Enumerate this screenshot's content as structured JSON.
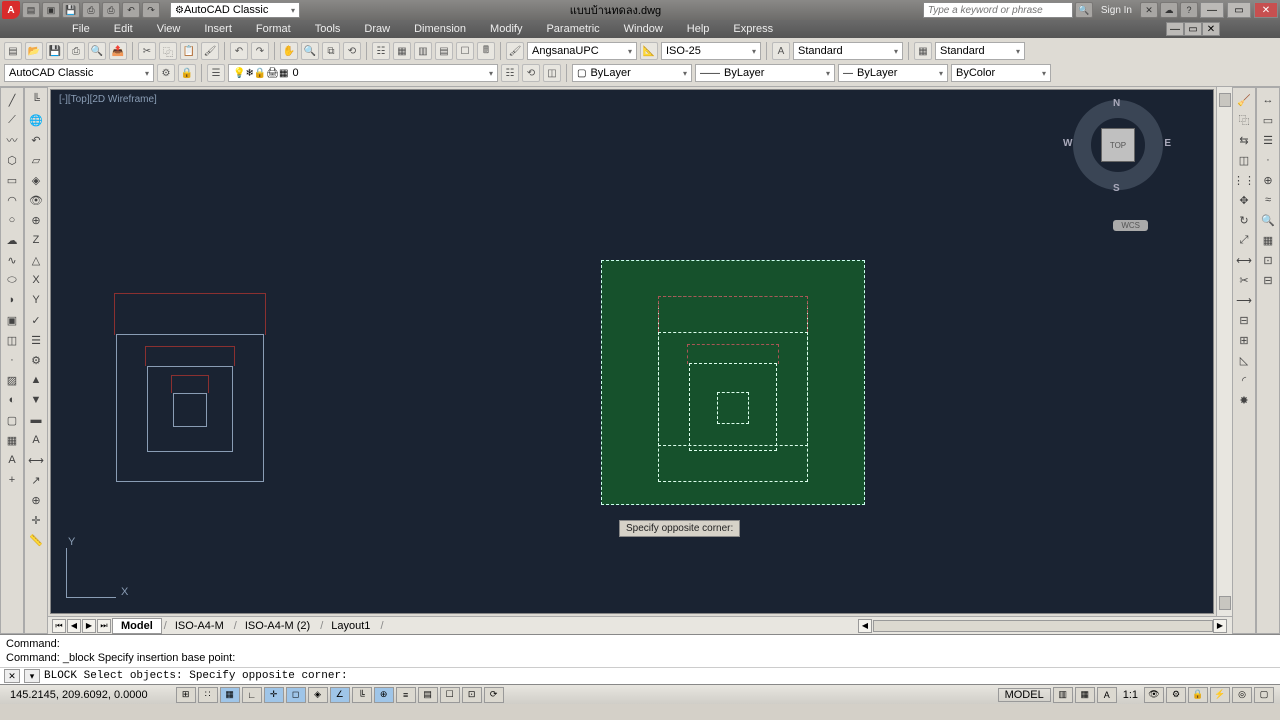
{
  "title": "แบบบ้านทดลง.dwg",
  "app_letter": "A",
  "workspace_selector": "AutoCAD Classic",
  "search_placeholder": "Type a keyword or phrase",
  "signin": "Sign In",
  "menus": [
    "File",
    "Edit",
    "View",
    "Insert",
    "Format",
    "Tools",
    "Draw",
    "Dimension",
    "Modify",
    "Parametric",
    "Window",
    "Help",
    "Express"
  ],
  "ribbon2": {
    "workspace": "AutoCAD Classic",
    "layer": "0",
    "font": "AngsanaUPC",
    "dimstyle": "ISO-25",
    "textstyle": "Standard",
    "tablestyle": "Standard",
    "bylayer1": "ByLayer",
    "bylayer2": "ByLayer",
    "bylayer3": "ByLayer",
    "bycolor": "ByColor"
  },
  "viewport_label": "[-][Top][2D Wireframe]",
  "viewcube": {
    "n": "N",
    "s": "S",
    "e": "E",
    "w": "W",
    "top": "TOP",
    "wcs": "WCS"
  },
  "ucs": {
    "x": "X",
    "y": "Y"
  },
  "tooltip": "Specify opposite corner:",
  "tabs": {
    "model": "Model",
    "l1": "ISO-A4-M",
    "l2": "ISO-A4-M (2)",
    "l3": "Layout1"
  },
  "cmd": {
    "line1": "Command:",
    "line2": "Command: _block Specify insertion base point:",
    "line3": "BLOCK Select objects: Specify opposite corner:"
  },
  "status": {
    "coords": "145.2145, 209.6092, 0.0000",
    "model": "MODEL",
    "scale": "1:1"
  }
}
